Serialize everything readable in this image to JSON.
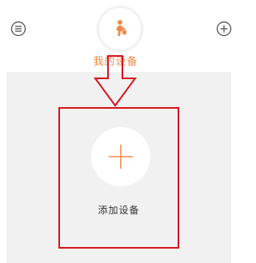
{
  "header": {
    "menu_icon": "menu-icon",
    "avatar_icon": "person-icon",
    "add_icon": "plus-icon",
    "title": "我的设备"
  },
  "main": {
    "add_device_label": "添加设备",
    "add_device_icon": "plus-icon"
  },
  "colors": {
    "accent": "#f08a4b",
    "annotation_red": "#d6111a",
    "background_gray": "#f1f1f1"
  }
}
